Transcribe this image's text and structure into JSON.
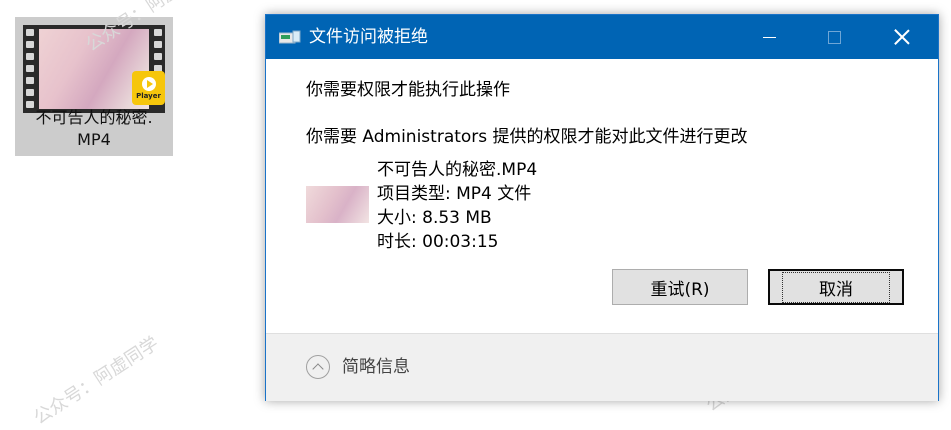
{
  "desktop_icon": {
    "label_line1": "不可告人的秘密.",
    "label_line2": "MP4",
    "badge_text": "Player",
    "icon": "video-file-icon"
  },
  "watermarks": [
    "公众号：阿虚同学",
    "公众号：阿虚同学",
    "公众号：阿虚同学",
    "公众号：阿虚同学"
  ],
  "dialog": {
    "title": "文件访问被拒绝",
    "title_icon": "folder-access-icon",
    "message": "你需要权限才能执行此操作",
    "detail": "你需要 Administrators 提供的权限才能对此文件进行更改",
    "file": {
      "name": "不可告人的秘密.MP4",
      "type": "项目类型: MP4 文件",
      "size": "大小: 8.53 MB",
      "duration": "时长: 00:03:15"
    },
    "buttons": {
      "retry": "重试(R)",
      "cancel": "取消"
    },
    "footer": {
      "toggle_label": "简略信息"
    }
  },
  "colors": {
    "titlebar": "#0064b4",
    "button_bg": "#e1e1e1",
    "footer_bg": "#f0f0f0"
  }
}
